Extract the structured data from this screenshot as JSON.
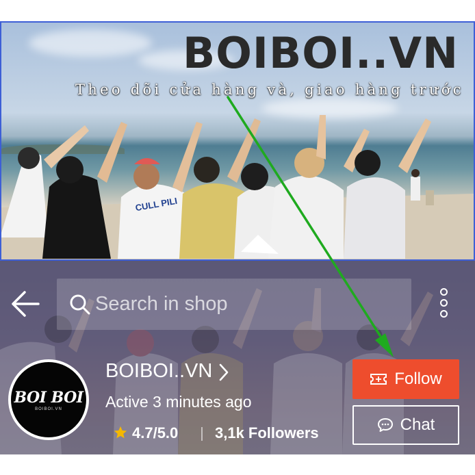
{
  "banner": {
    "title": "BOIBOI..VN",
    "subtitle": "Theo dõi cửa hàng và, giao hàng trước",
    "shirt_text": "CULL PILI"
  },
  "search": {
    "placeholder": "Search in shop"
  },
  "shop": {
    "name": "BOIBOI..VN",
    "active_status": "Active 3 minutes ago",
    "rating": "4.7/5.0",
    "followers": "3,1k Followers",
    "avatar_brand": "BOI BOI",
    "avatar_sub": "BOIBOI.VN"
  },
  "actions": {
    "follow_label": "Follow",
    "chat_label": "Chat"
  },
  "colors": {
    "follow_button": "#ee4d2d",
    "banner_border": "#3d5fd6",
    "annotation_arrow": "#1faa1f",
    "star": "#f5b800"
  },
  "icons": [
    "back-arrow-icon",
    "search-icon",
    "more-vertical-icon",
    "chevron-right-icon",
    "star-icon",
    "ticket-icon",
    "chat-bubble-icon"
  ]
}
